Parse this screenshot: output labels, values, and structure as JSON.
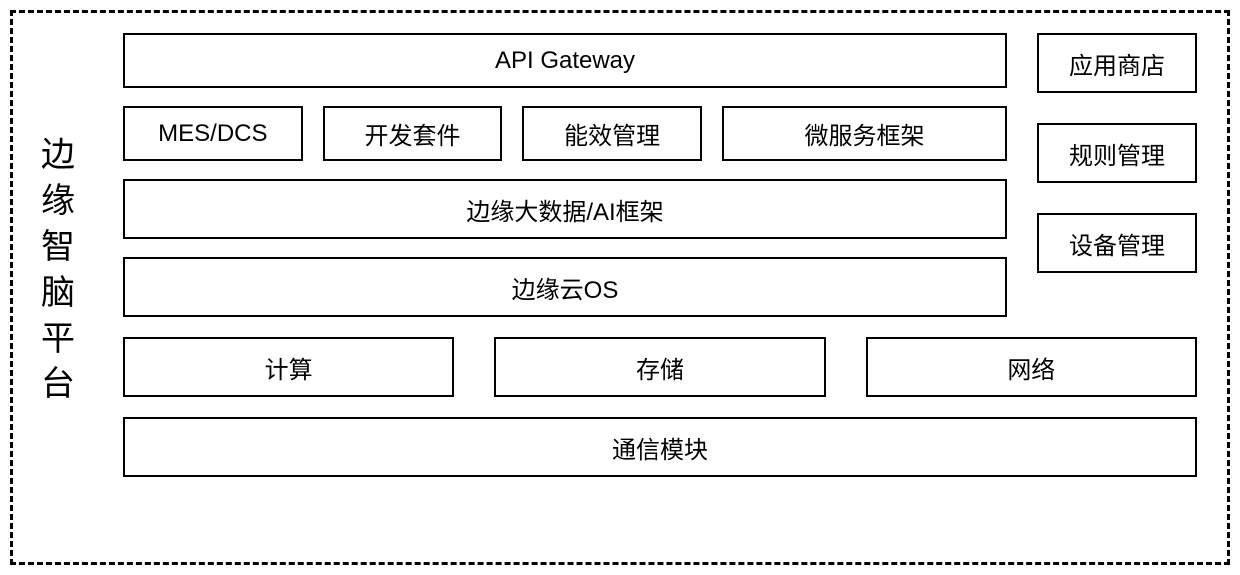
{
  "title": "边缘智脑平台",
  "upper": {
    "api_gateway": "API Gateway",
    "services": {
      "mes_dcs": "MES/DCS",
      "dev_kit": "开发套件",
      "energy_mgmt": "能效管理",
      "microservice": "微服务框架"
    },
    "bigdata_ai": "边缘大数据/AI框架",
    "edge_os": "边缘云OS",
    "side": {
      "app_store": "应用商店",
      "rule_mgmt": "规则管理",
      "device_mgmt": "设备管理"
    }
  },
  "infra": {
    "compute": "计算",
    "storage": "存储",
    "network": "网络"
  },
  "comm_module": "通信模块"
}
